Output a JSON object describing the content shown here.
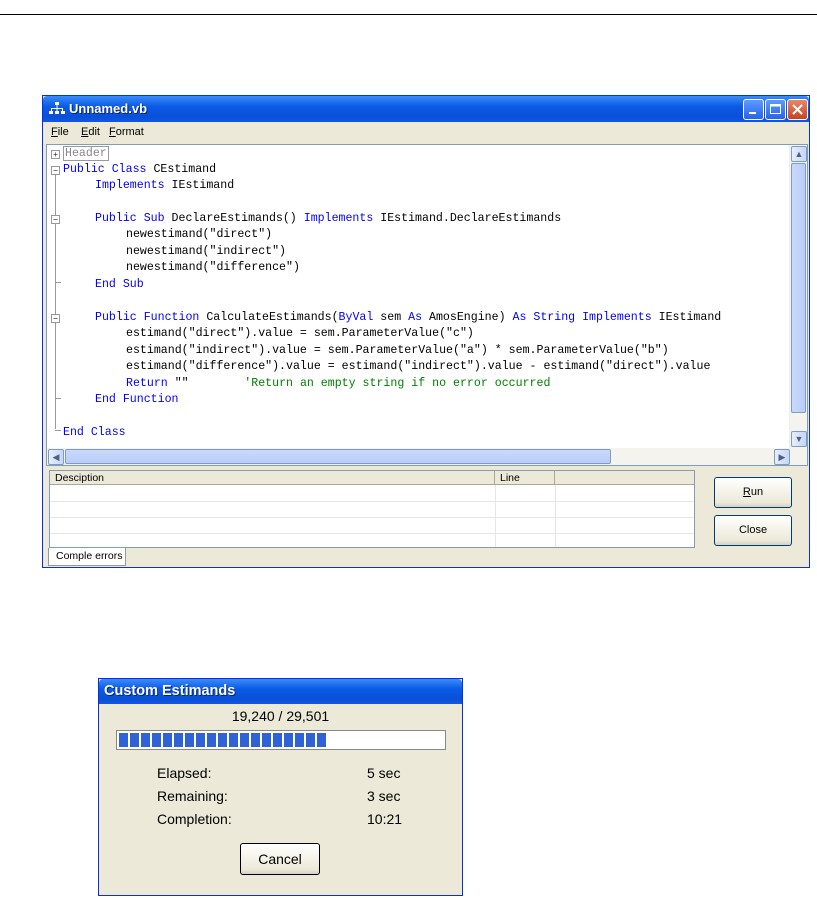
{
  "editor_window": {
    "title": "Unnamed.vb",
    "menu": [
      {
        "mn": "F",
        "rest": "ile"
      },
      {
        "mn": "E",
        "rest": "dit"
      },
      {
        "mn": "F",
        "rest": "ormat"
      }
    ],
    "code": {
      "header": "Header",
      "lines": [
        "Public Class CEstimand",
        "Implements IEstimand",
        "",
        "Public Sub DeclareEstimands() Implements IEstimand.DeclareEstimands",
        "newestimand(\"direct\")",
        "newestimand(\"indirect\")",
        "newestimand(\"difference\")",
        "End Sub",
        "",
        "Public Function CalculateEstimands(ByVal sem As AmosEngine) As String Implements IEstimand",
        "estimand(\"direct\").value = sem.ParameterValue(\"c\")",
        "estimand(\"indirect\").value = sem.ParameterValue(\"a\") * sem.ParameterValue(\"b\")",
        "estimand(\"difference\").value = estimand(\"indirect\").value - estimand(\"direct\").value",
        "Return \"\"        'Return an empty string if no error occurred",
        "End Function",
        "",
        "End Class"
      ]
    },
    "error_list": {
      "columns": [
        "Desciption",
        "Line",
        ""
      ]
    },
    "run_button": {
      "mn": "R",
      "rest": "un"
    },
    "close_button": "Close",
    "tab": "Comple errors"
  },
  "progress_dialog": {
    "title": "Custom Estimands",
    "count_text": "19,240 / 29,501",
    "progress_fraction": 0.652,
    "stats": [
      {
        "label": "Elapsed:",
        "value": "5 sec"
      },
      {
        "label": "Remaining:",
        "value": "3 sec"
      },
      {
        "label": "Completion:",
        "value": "10:21"
      }
    ],
    "cancel_button": "Cancel"
  },
  "colors": {
    "keyword": "#0000ff",
    "comment": "#008000",
    "titlebar": "#0b5be6",
    "progress": "#2f62d6"
  }
}
